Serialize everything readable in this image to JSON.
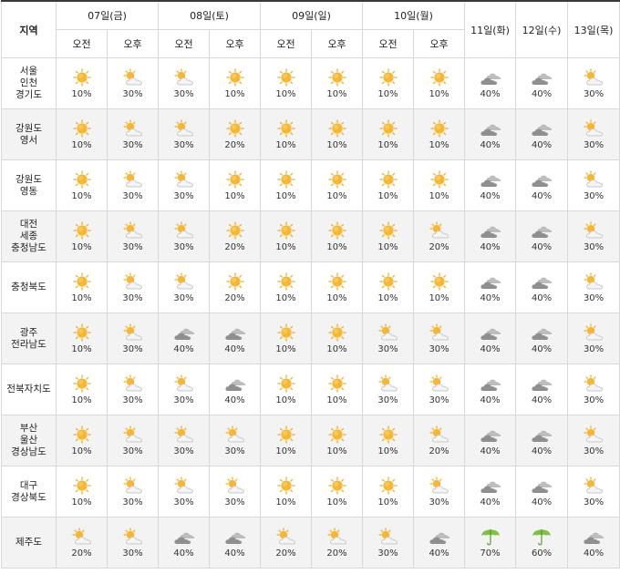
{
  "header": {
    "region_label": "지역",
    "days": [
      {
        "label": "07일(금)",
        "split": true
      },
      {
        "label": "08일(토)",
        "split": true
      },
      {
        "label": "09일(일)",
        "split": true
      },
      {
        "label": "10일(월)",
        "split": true
      },
      {
        "label": "11일(화)",
        "split": false
      },
      {
        "label": "12일(수)",
        "split": false
      },
      {
        "label": "13일(목)",
        "split": false
      }
    ],
    "am_label": "오전",
    "pm_label": "오후"
  },
  "colors": {
    "sun": "#f5b335",
    "cloud": "#9a9a9a",
    "umbrella": "#7dc242",
    "header_border": "#3a3a3a",
    "alt_row": "#f3f3f3"
  },
  "regions": [
    {
      "name": [
        "서울",
        "인천",
        "경기도"
      ],
      "cells": [
        [
          "sunny",
          "10%"
        ],
        [
          "partly-cloudy",
          "30%"
        ],
        [
          "partly-cloudy",
          "30%"
        ],
        [
          "sunny",
          "10%"
        ],
        [
          "sunny",
          "10%"
        ],
        [
          "sunny",
          "10%"
        ],
        [
          "sunny",
          "10%"
        ],
        [
          "sunny",
          "10%"
        ],
        [
          "cloudy",
          "40%"
        ],
        [
          "cloudy",
          "40%"
        ],
        [
          "partly-cloudy",
          "30%"
        ]
      ]
    },
    {
      "name": [
        "강원도",
        "영서"
      ],
      "cells": [
        [
          "sunny",
          "10%"
        ],
        [
          "partly-cloudy",
          "30%"
        ],
        [
          "partly-cloudy",
          "30%"
        ],
        [
          "sunny",
          "20%"
        ],
        [
          "sunny",
          "10%"
        ],
        [
          "sunny",
          "10%"
        ],
        [
          "sunny",
          "10%"
        ],
        [
          "sunny",
          "10%"
        ],
        [
          "cloudy",
          "40%"
        ],
        [
          "cloudy",
          "40%"
        ],
        [
          "partly-cloudy",
          "30%"
        ]
      ]
    },
    {
      "name": [
        "강원도",
        "영동"
      ],
      "cells": [
        [
          "sunny",
          "10%"
        ],
        [
          "partly-cloudy",
          "30%"
        ],
        [
          "partly-cloudy",
          "30%"
        ],
        [
          "sunny",
          "10%"
        ],
        [
          "sunny",
          "10%"
        ],
        [
          "sunny",
          "10%"
        ],
        [
          "sunny",
          "10%"
        ],
        [
          "sunny",
          "10%"
        ],
        [
          "cloudy",
          "40%"
        ],
        [
          "cloudy",
          "40%"
        ],
        [
          "partly-cloudy",
          "30%"
        ]
      ]
    },
    {
      "name": [
        "대전",
        "세종",
        "충청남도"
      ],
      "cells": [
        [
          "sunny",
          "10%"
        ],
        [
          "partly-cloudy",
          "30%"
        ],
        [
          "partly-cloudy",
          "30%"
        ],
        [
          "sunny",
          "20%"
        ],
        [
          "sunny",
          "10%"
        ],
        [
          "sunny",
          "10%"
        ],
        [
          "sunny",
          "10%"
        ],
        [
          "partly-cloudy",
          "20%"
        ],
        [
          "cloudy",
          "40%"
        ],
        [
          "cloudy",
          "40%"
        ],
        [
          "partly-cloudy",
          "30%"
        ]
      ]
    },
    {
      "name": [
        "충청북도"
      ],
      "cells": [
        [
          "sunny",
          "10%"
        ],
        [
          "partly-cloudy",
          "30%"
        ],
        [
          "partly-cloudy",
          "30%"
        ],
        [
          "sunny",
          "20%"
        ],
        [
          "sunny",
          "10%"
        ],
        [
          "sunny",
          "10%"
        ],
        [
          "sunny",
          "10%"
        ],
        [
          "sunny",
          "10%"
        ],
        [
          "cloudy",
          "40%"
        ],
        [
          "cloudy",
          "40%"
        ],
        [
          "partly-cloudy",
          "30%"
        ]
      ]
    },
    {
      "name": [
        "광주",
        "전라남도"
      ],
      "cells": [
        [
          "sunny",
          "10%"
        ],
        [
          "partly-cloudy",
          "30%"
        ],
        [
          "cloudy",
          "40%"
        ],
        [
          "cloudy",
          "40%"
        ],
        [
          "sunny",
          "10%"
        ],
        [
          "sunny",
          "10%"
        ],
        [
          "partly-cloudy",
          "30%"
        ],
        [
          "partly-cloudy",
          "30%"
        ],
        [
          "cloudy",
          "40%"
        ],
        [
          "cloudy",
          "40%"
        ],
        [
          "partly-cloudy",
          "30%"
        ]
      ]
    },
    {
      "name": [
        "전북자치도"
      ],
      "cells": [
        [
          "sunny",
          "10%"
        ],
        [
          "partly-cloudy",
          "30%"
        ],
        [
          "partly-cloudy",
          "30%"
        ],
        [
          "cloudy",
          "40%"
        ],
        [
          "sunny",
          "10%"
        ],
        [
          "sunny",
          "10%"
        ],
        [
          "partly-cloudy",
          "30%"
        ],
        [
          "partly-cloudy",
          "30%"
        ],
        [
          "cloudy",
          "40%"
        ],
        [
          "cloudy",
          "40%"
        ],
        [
          "partly-cloudy",
          "30%"
        ]
      ]
    },
    {
      "name": [
        "부산",
        "울산",
        "경상남도"
      ],
      "cells": [
        [
          "sunny",
          "10%"
        ],
        [
          "partly-cloudy",
          "30%"
        ],
        [
          "partly-cloudy",
          "30%"
        ],
        [
          "partly-cloudy",
          "30%"
        ],
        [
          "sunny",
          "10%"
        ],
        [
          "sunny",
          "10%"
        ],
        [
          "sunny",
          "10%"
        ],
        [
          "partly-cloudy",
          "20%"
        ],
        [
          "cloudy",
          "40%"
        ],
        [
          "cloudy",
          "40%"
        ],
        [
          "partly-cloudy",
          "30%"
        ]
      ]
    },
    {
      "name": [
        "대구",
        "경상북도"
      ],
      "cells": [
        [
          "sunny",
          "10%"
        ],
        [
          "partly-cloudy",
          "30%"
        ],
        [
          "partly-cloudy",
          "30%"
        ],
        [
          "partly-cloudy",
          "30%"
        ],
        [
          "sunny",
          "10%"
        ],
        [
          "sunny",
          "10%"
        ],
        [
          "sunny",
          "10%"
        ],
        [
          "partly-cloudy",
          "30%"
        ],
        [
          "cloudy",
          "40%"
        ],
        [
          "cloudy",
          "40%"
        ],
        [
          "partly-cloudy",
          "30%"
        ]
      ]
    },
    {
      "name": [
        "제주도"
      ],
      "cells": [
        [
          "partly-cloudy",
          "20%"
        ],
        [
          "partly-cloudy",
          "30%"
        ],
        [
          "cloudy",
          "40%"
        ],
        [
          "cloudy",
          "40%"
        ],
        [
          "partly-cloudy",
          "20%"
        ],
        [
          "partly-cloudy",
          "20%"
        ],
        [
          "partly-cloudy",
          "30%"
        ],
        [
          "cloudy",
          "40%"
        ],
        [
          "rain-umbrella",
          "70%"
        ],
        [
          "rain-umbrella",
          "60%"
        ],
        [
          "cloudy",
          "40%"
        ]
      ]
    }
  ]
}
